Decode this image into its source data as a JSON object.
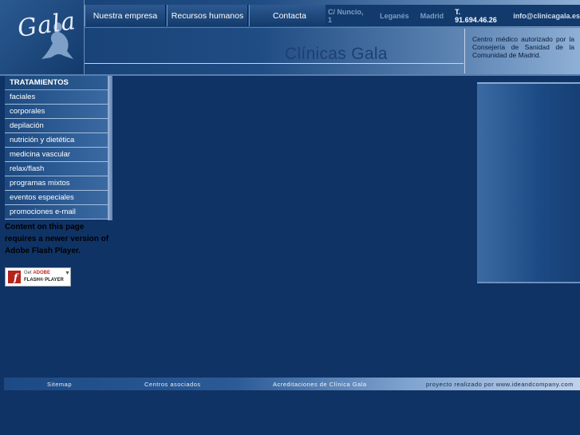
{
  "header": {
    "logo_text": "Gala",
    "site_title": "Clínicas Gala",
    "notice": "Centro médico autorizado por la Consejería de Sanidad de la Comunidad de Madrid."
  },
  "topnav": {
    "items": [
      "Nuestra empresa",
      "Recursos humanos",
      "Contacta"
    ]
  },
  "contact": {
    "address": "C/ Nuncio, 1",
    "city1": "Leganés",
    "city2": "Madrid",
    "phone": "T. 91.694.46.26",
    "email": "info@clinicagala.es"
  },
  "menu": {
    "heading": "TRATAMIENTOS",
    "items": [
      "faciales",
      "corporales",
      "depilación",
      "nutrición y dietética",
      "medicina vascular",
      "relax/flash",
      "programas mixtos",
      "eventos especiales",
      "promociones e-mail"
    ]
  },
  "flash": {
    "message": "Content on this page requires a newer version of Adobe Flash Player.",
    "btn_get": "Get",
    "btn_adobe": "ADOBE",
    "btn_player": "FLASH® PLAYER"
  },
  "footer": {
    "sitemap": "Sitemap",
    "centros": "Centros asociados",
    "acreditaciones": "Acreditaciones de Clínica Gala",
    "credits": "proyecto realizado por www.ideandcompany.com"
  },
  "colors": {
    "background": "#0f3365",
    "nav": "#1f4c83"
  }
}
